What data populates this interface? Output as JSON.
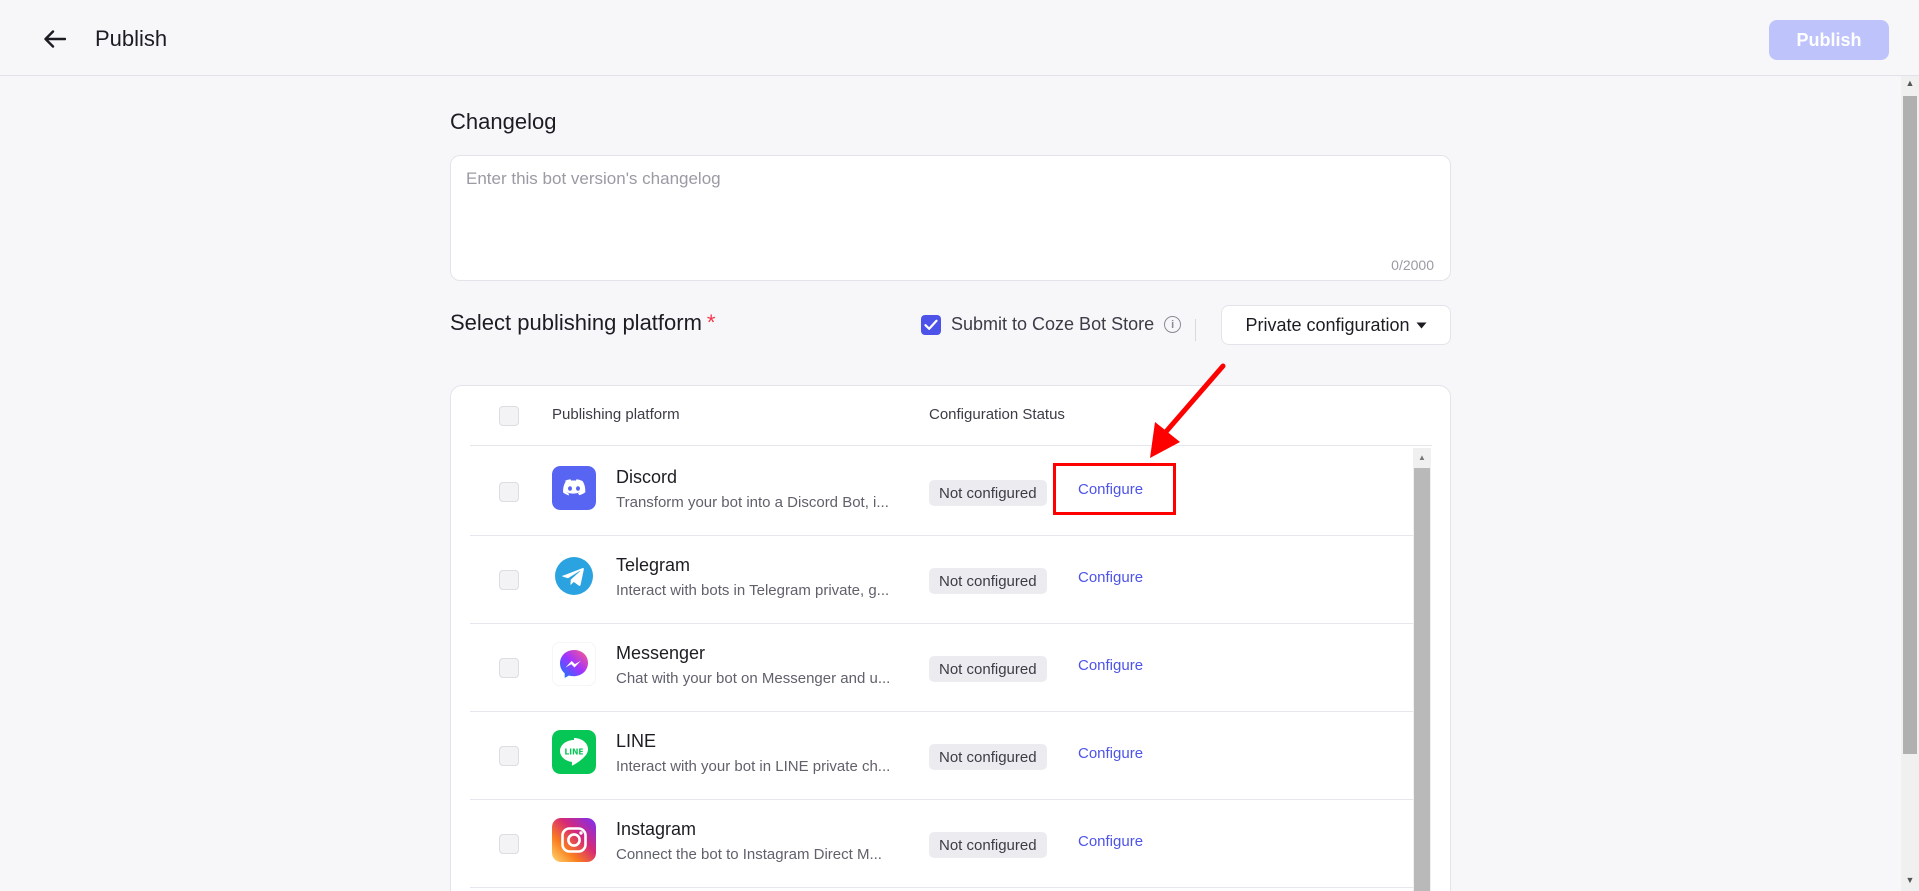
{
  "header": {
    "title": "Publish",
    "publish_label": "Publish",
    "back_icon": "arrow-left-icon"
  },
  "changelog": {
    "title": "Changelog",
    "placeholder": "Enter this bot version's changelog",
    "value": "",
    "char_count": "0/2000"
  },
  "platform_section": {
    "title": "Select publishing platform",
    "required_mark": "*",
    "store_checkbox_label": "Submit to Coze Bot Store",
    "store_checked": true,
    "private_config_label": "Private configuration"
  },
  "table": {
    "columns": [
      "Publishing platform",
      "Configuration Status"
    ],
    "rows": [
      {
        "name": "Discord",
        "description": "Transform your bot into a Discord Bot, i...",
        "status": "Not configured",
        "action": "Configure",
        "icon": "discord-icon"
      },
      {
        "name": "Telegram",
        "description": "Interact with bots in Telegram private, g...",
        "status": "Not configured",
        "action": "Configure",
        "icon": "telegram-icon"
      },
      {
        "name": "Messenger",
        "description": "Chat with your bot on Messenger and u...",
        "status": "Not configured",
        "action": "Configure",
        "icon": "messenger-icon"
      },
      {
        "name": "LINE",
        "description": "Interact with your bot in LINE private ch...",
        "status": "Not configured",
        "action": "Configure",
        "icon": "line-icon"
      },
      {
        "name": "Instagram",
        "description": "Connect the bot to Instagram Direct M...",
        "status": "Not configured",
        "action": "Configure",
        "icon": "instagram-icon"
      }
    ]
  },
  "colors": {
    "accent": "#4d53e8",
    "publish_disabled": "#bfc3fb",
    "annotation_red": "#ff0000"
  }
}
